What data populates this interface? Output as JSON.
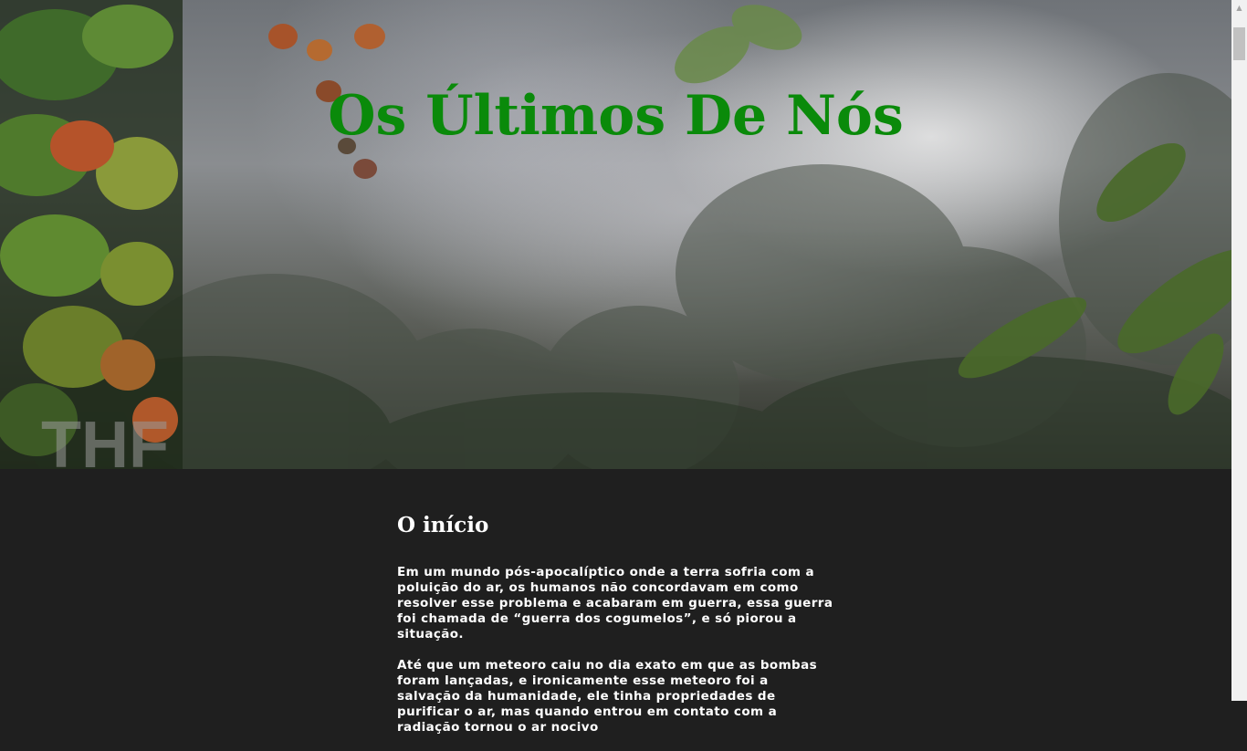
{
  "hero": {
    "title": "Os Últimos De Nós",
    "watermark": "THF"
  },
  "section": {
    "heading": "O início",
    "paragraphs": [
      "Em um mundo pós-apocalíptico onde a terra sofria com a poluição do ar, os humanos não concordavam em como resolver esse problema e acabaram em guerra, essa guerra foi chamada de “guerra dos cogumelos”, e só piorou a situação.",
      "Até que um meteoro caiu no dia exato em que as bombas foram lançadas, e ironicamente esse meteoro foi a salvação da humanidade, ele tinha propriedades de purificar o ar, mas quando entrou em contato com a radiação tornou o ar nocivo"
    ]
  },
  "colors": {
    "title": "#0a8a0a",
    "page_background": "#1f1f1f",
    "text": "#ffffff"
  }
}
